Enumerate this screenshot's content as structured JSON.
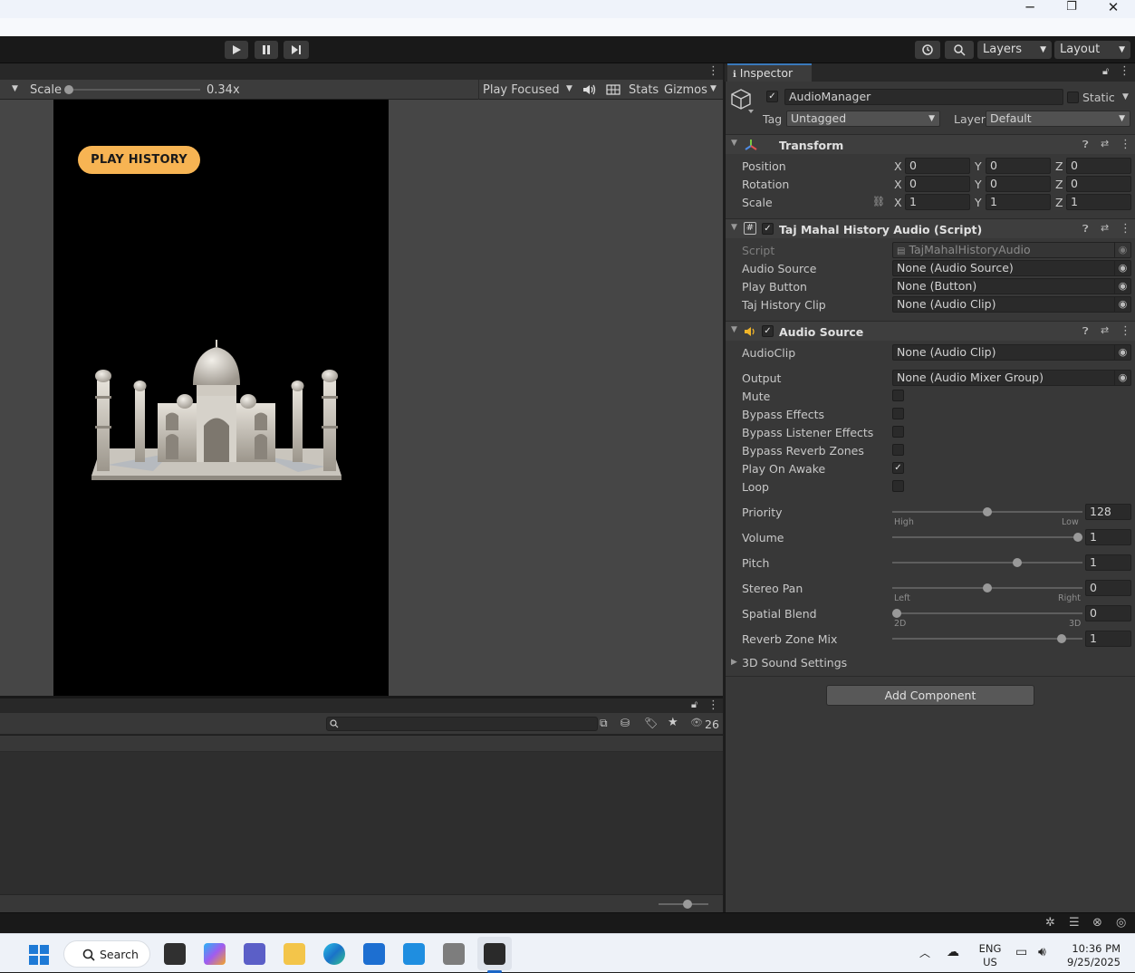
{
  "window": {
    "minimize": "─",
    "restore": "❐",
    "close": "✕"
  },
  "toolbar": {
    "layers_label": "Layers",
    "layout_label": "Layout"
  },
  "game_view": {
    "scale_label": "Scale",
    "scale_value": "0.34x",
    "scale_level": 0,
    "play_focused": "Play Focused",
    "stats_label": "Stats",
    "gizmos_label": "Gizmos",
    "play_history_button": "PLAY HISTORY"
  },
  "bottom_panel": {
    "hidden_count": "26"
  },
  "inspector": {
    "tab_label": "Inspector",
    "object_name": "AudioManager",
    "static_label": "Static",
    "tag_label": "Tag",
    "tag_value": "Untagged",
    "layer_label": "Layer",
    "layer_value": "Default",
    "transform": {
      "title": "Transform",
      "position_label": "Position",
      "rotation_label": "Rotation",
      "scale_label": "Scale",
      "axes": [
        "X",
        "Y",
        "Z"
      ],
      "position": [
        "0",
        "0",
        "0"
      ],
      "rotation": [
        "0",
        "0",
        "0"
      ],
      "scale": [
        "1",
        "1",
        "1"
      ]
    },
    "script_component": {
      "title": "Taj Mahal History Audio (Script)",
      "script_label": "Script",
      "script_value": "TajMahalHistoryAudio",
      "audio_source_label": "Audio Source",
      "audio_source_value": "None (Audio Source)",
      "play_button_label": "Play Button",
      "play_button_value": "None (Button)",
      "clip_label": "Taj History Clip",
      "clip_value": "None (Audio Clip)"
    },
    "audio_source": {
      "title": "Audio Source",
      "audioclip_label": "AudioClip",
      "audioclip_value": "None (Audio Clip)",
      "output_label": "Output",
      "output_value": "None (Audio Mixer Group)",
      "mute_label": "Mute",
      "bypass_effects_label": "Bypass Effects",
      "bypass_listener_label": "Bypass Listener Effects",
      "bypass_reverb_label": "Bypass Reverb Zones",
      "play_on_awake_label": "Play On Awake",
      "loop_label": "Loop",
      "mute": false,
      "bypass_effects": false,
      "bypass_listener": false,
      "bypass_reverb": false,
      "play_on_awake": true,
      "loop": false,
      "priority_label": "Priority",
      "priority_value": "128",
      "priority_high": "High",
      "priority_low": "Low",
      "volume_label": "Volume",
      "volume_value": "1",
      "pitch_label": "Pitch",
      "pitch_value": "1",
      "stereo_pan_label": "Stereo Pan",
      "stereo_pan_value": "0",
      "pan_left": "Left",
      "pan_right": "Right",
      "spatial_blend_label": "Spatial Blend",
      "spatial_blend_value": "0",
      "blend_2d": "2D",
      "blend_3d": "3D",
      "reverb_mix_label": "Reverb Zone Mix",
      "reverb_mix_value": "1",
      "sound_settings_label": "3D Sound Settings"
    },
    "add_component": "Add Component"
  },
  "taskbar": {
    "search_label": "Search",
    "lang_top": "ENG",
    "lang_bottom": "US",
    "time": "10:36 PM",
    "date": "9/25/2025"
  }
}
